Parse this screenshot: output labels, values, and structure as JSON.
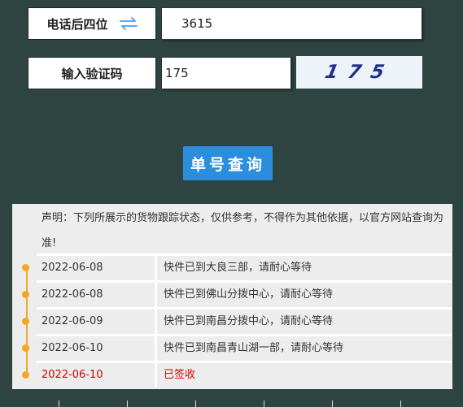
{
  "form": {
    "phone_label": "电话后四位",
    "phone_value": "3615",
    "captcha_label": "输入验证码",
    "captcha_value": "175",
    "captcha_image_text": "1 7 5",
    "query_button": "单号查询"
  },
  "results": {
    "disclaimer": "声明：下列所展示的货物跟踪状态，仅供参考，不得作为其他依据，以官方网站查询为准!",
    "entries": [
      {
        "date": "2022-06-08",
        "status": "快件已到大良三部，请耐心等待"
      },
      {
        "date": "2022-06-08",
        "status": "快件已到佛山分拨中心，请耐心等待"
      },
      {
        "date": "2022-06-09",
        "status": "快件已到南昌分拨中心，请耐心等待"
      },
      {
        "date": "2022-06-10",
        "status": "快件已到南昌青山湖一部，请耐心等待"
      },
      {
        "date": "2022-06-10",
        "status": "已签收"
      }
    ]
  },
  "colors": {
    "background": "#2e4440",
    "button": "#2d8ddd",
    "timeline": "#f5a623",
    "latest_status": "#d40000",
    "panel": "#ededed",
    "captcha_text": "#1f2f8a"
  },
  "icons": {
    "swap": "swap-arrows-icon"
  }
}
